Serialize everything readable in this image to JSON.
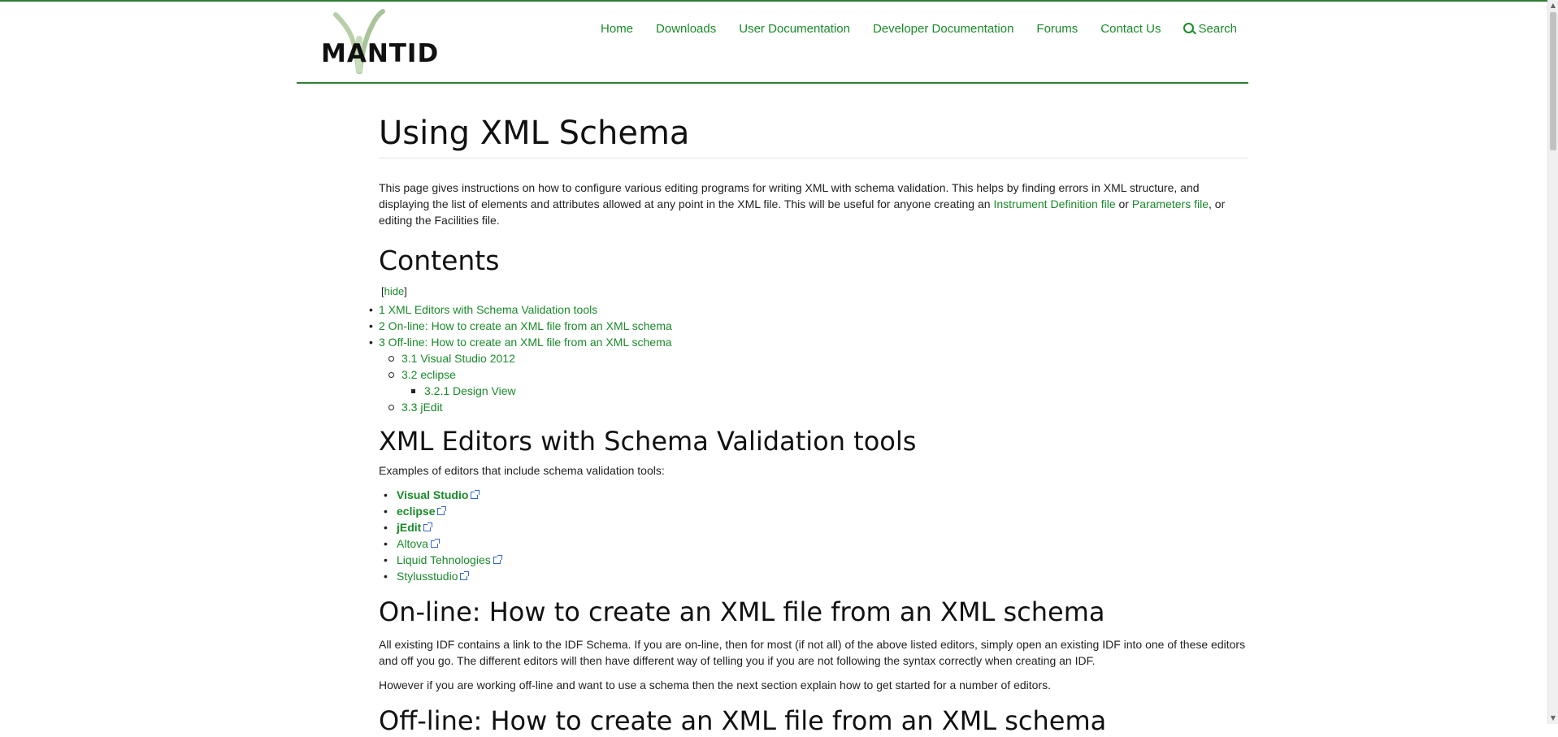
{
  "header": {
    "logo_text": "MANTID",
    "nav": [
      {
        "label": "Home"
      },
      {
        "label": "Downloads"
      },
      {
        "label": "User Documentation"
      },
      {
        "label": "Developer Documentation"
      },
      {
        "label": "Forums"
      },
      {
        "label": "Contact Us"
      },
      {
        "label": "Search",
        "icon": "search-icon"
      }
    ]
  },
  "page": {
    "title": "Using XML Schema",
    "intro": {
      "text_1": "This page gives instructions on how to configure various editing programs for writing XML with schema validation. This helps by finding errors in XML structure, and displaying the list of elements and attributes allowed at any point in the XML file. This will be useful for anyone creating an ",
      "link_1": "Instrument Definition file",
      "text_2": " or ",
      "link_2": "Parameters file",
      "text_3": ", or editing the Facilities file."
    },
    "contents": {
      "heading": "Contents",
      "toggle_open": "[",
      "toggle_label": "hide",
      "toggle_close": "]",
      "items": [
        {
          "label": "1 XML Editors with Schema Validation tools",
          "level": 1
        },
        {
          "label": "2 On-line: How to create an XML file from an XML schema",
          "level": 1
        },
        {
          "label": "3 Off-line: How to create an XML file from an XML schema",
          "level": 1
        },
        {
          "label": "3.1 Visual Studio 2012",
          "level": 2
        },
        {
          "label": "3.2 eclipse",
          "level": 2
        },
        {
          "label": "3.2.1 Design View",
          "level": 3
        },
        {
          "label": "3.3 jEdit",
          "level": 2
        }
      ]
    },
    "section_1": {
      "heading": "XML Editors with Schema Validation tools",
      "intro": "Examples of editors that include schema validation tools:",
      "editors": [
        {
          "label": "Visual Studio",
          "bold": true
        },
        {
          "label": "eclipse",
          "bold": true
        },
        {
          "label": "jEdit",
          "bold": true
        },
        {
          "label": "Altova",
          "bold": false
        },
        {
          "label": "Liquid Tehnologies",
          "bold": false
        },
        {
          "label": "Stylusstudio",
          "bold": false
        }
      ]
    },
    "section_2": {
      "heading": "On-line: How to create an XML file from an XML schema",
      "para_1": "All existing IDF contains a link to the IDF Schema. If you are on-line, then for most (if not all) of the above listed editors, simply open an existing IDF into one of these editors and off you go. The different editors will then have different way of telling you if you are not following the syntax correctly when creating an IDF.",
      "para_2": "However if you are working off-line and want to use a schema then the next section explain how to get started for a number of editors."
    },
    "section_3": {
      "heading": "Off-line: How to create an XML file from an XML schema"
    }
  },
  "colors": {
    "accent_green": "#1a8a2a",
    "rule_green": "#2e7d32",
    "external_link_icon": "#3366cc"
  }
}
